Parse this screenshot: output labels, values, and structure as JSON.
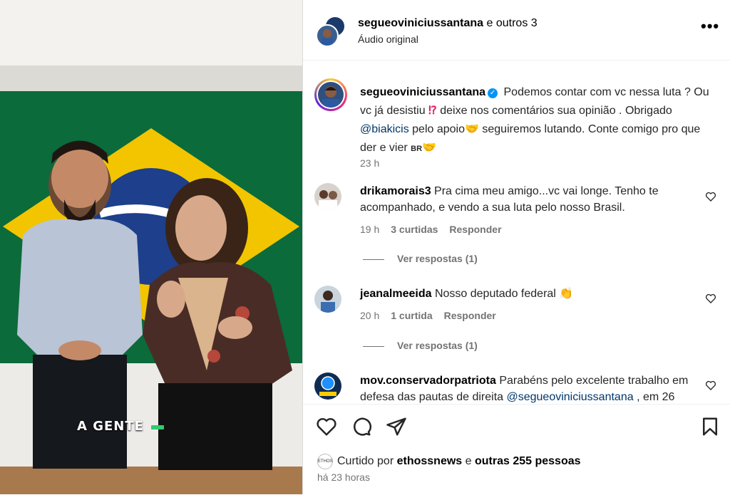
{
  "media": {
    "overlay_caption": "A GENTE"
  },
  "header": {
    "username": "segueoviniciussantana",
    "and_others": "e outros 3",
    "subtitle": "Áudio original",
    "more": "•••"
  },
  "caption": {
    "username": "segueoviniciussantana",
    "verified": "✓",
    "text_part1": " Podemos contar com vc nessa luta ? Ou vc já desistiu ",
    "emoji1": "⁉",
    "text_part2": " deixe nos comentários sua opinião . Obrigado ",
    "mention": "@biakicis",
    "text_part3": " pelo apoio",
    "emoji2": "🤝",
    "text_part4": "  seguiremos lutando. Conte comigo pro que der e vier ",
    "flag": "BR",
    "emoji3": "🤝",
    "time": "23 h"
  },
  "comments": [
    {
      "username": "drikamorais3",
      "text": " Pra cima meu amigo...vc vai longe. Tenho te acompanhado, e vendo a sua luta pelo nosso Brasil.",
      "time": "19 h",
      "likes": "3 curtidas",
      "reply": "Responder",
      "view_replies": "Ver respostas (1)"
    },
    {
      "username": "jeanalmeeida",
      "text": " Nosso deputado federal ",
      "emoji": "👏",
      "time": "20 h",
      "likes": "1 curtida",
      "reply": "Responder",
      "view_replies": "Ver respostas (1)"
    },
    {
      "username": "mov.conservadorpatriota",
      "text": " Parabéns pelo excelente trabalho em defesa das pautas de direita ",
      "mention": "@segueoviniciussantana",
      "text_tail": " , em 26"
    }
  ],
  "footer": {
    "liked_by": "Curtido por ",
    "liker": "ethossnews",
    "and": " e ",
    "others": "outras 255 pessoas",
    "liker_icon": "ETHOS",
    "time": "há 23 horas"
  }
}
